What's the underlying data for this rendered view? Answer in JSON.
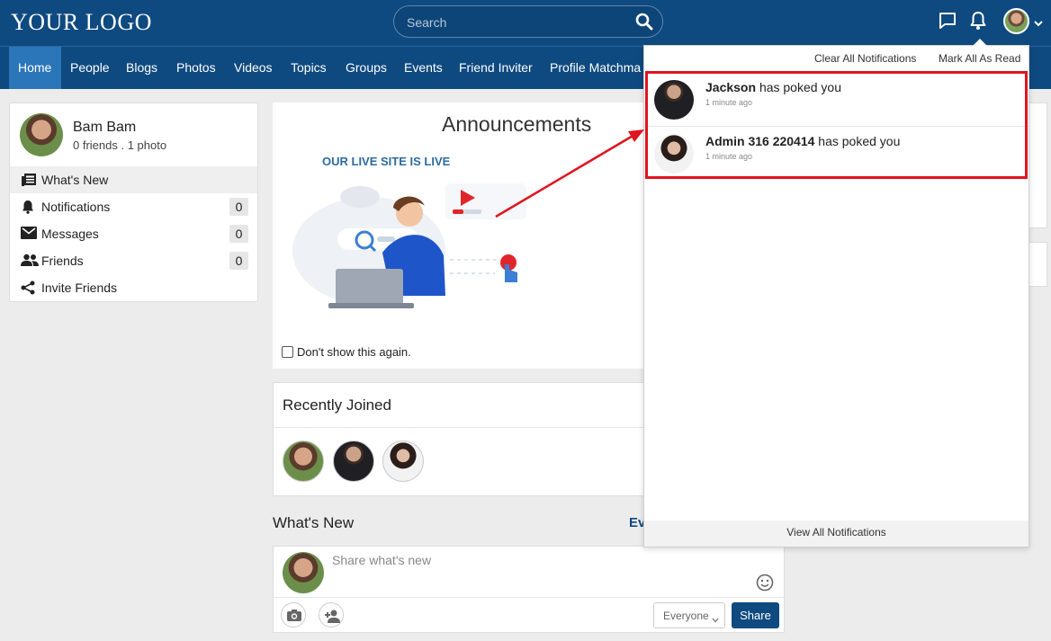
{
  "header": {
    "logo": "YOUR LOGO",
    "search_placeholder": "Search"
  },
  "nav": {
    "items": [
      "Home",
      "People",
      "Blogs",
      "Photos",
      "Videos",
      "Topics",
      "Groups",
      "Events",
      "Friend Inviter",
      "Profile Matchma"
    ],
    "active": "Home"
  },
  "profile": {
    "name": "Bam Bam",
    "meta": "0 friends . 1 photo"
  },
  "sidebar": {
    "items": [
      {
        "label": "What's New",
        "count": null
      },
      {
        "label": "Notifications",
        "count": "0"
      },
      {
        "label": "Messages",
        "count": "0"
      },
      {
        "label": "Friends",
        "count": "0"
      },
      {
        "label": "Invite Friends",
        "count": null
      }
    ]
  },
  "announcement": {
    "title": "Announcements",
    "subtitle": "OUR LIVE SITE IS LIVE",
    "dont_show": "Don't show this again."
  },
  "recently_joined": {
    "title": "Recently Joined"
  },
  "whats_new": {
    "title": "What's New",
    "partial_link": "Ev"
  },
  "composer": {
    "placeholder": "Share what's new",
    "privacy": "Everyone",
    "share": "Share"
  },
  "notifications": {
    "clear_all": "Clear All Notifications",
    "mark_all_read": "Mark All As Read",
    "items": [
      {
        "actor": "Jackson",
        "action": "has poked you",
        "time": "1 minute ago"
      },
      {
        "actor": "Admin 316 220414",
        "action": "has poked you",
        "time": "1 minute ago"
      }
    ],
    "view_all": "View All Notifications"
  },
  "colors": {
    "header_bg": "#0e4a80",
    "nav_active": "#2b76b9",
    "highlight": "#e0141e"
  },
  "icons": [
    "search-icon",
    "chat-icon",
    "bell-icon",
    "chevron-down-icon",
    "newspaper-icon",
    "bell-icon",
    "mail-icon",
    "people-icon",
    "share-icon",
    "smiley-icon",
    "camera-icon",
    "add-person-icon"
  ]
}
